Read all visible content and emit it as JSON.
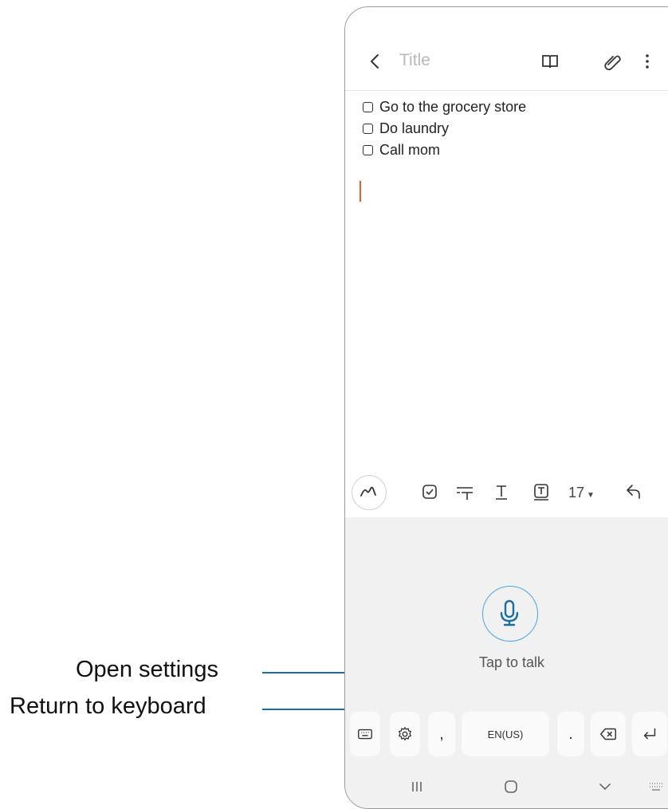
{
  "note": {
    "title_placeholder": "Title",
    "items": [
      "Go to the grocery store",
      "Do laundry",
      "Call mom"
    ]
  },
  "toolbar": {
    "font_size": "17"
  },
  "voice": {
    "tap_label": "Tap to talk"
  },
  "keyboard": {
    "comma": ",",
    "space_label": "EN(US)",
    "period": "."
  },
  "callouts": {
    "open_settings": "Open settings",
    "return_keyboard": "Return to keyboard"
  },
  "colors": {
    "accent": "#1a6fa0",
    "mic": "#4aa5dc",
    "cursor": "#e85a3c"
  },
  "icons": [
    "back-icon",
    "book-icon",
    "attach-icon",
    "more-icon",
    "pen-icon",
    "checkbox-icon",
    "text-style-icon",
    "text-format-icon",
    "text-box-icon",
    "undo-icon",
    "mic-icon",
    "keyboard-icon",
    "settings-icon",
    "backspace-icon",
    "enter-icon"
  ]
}
